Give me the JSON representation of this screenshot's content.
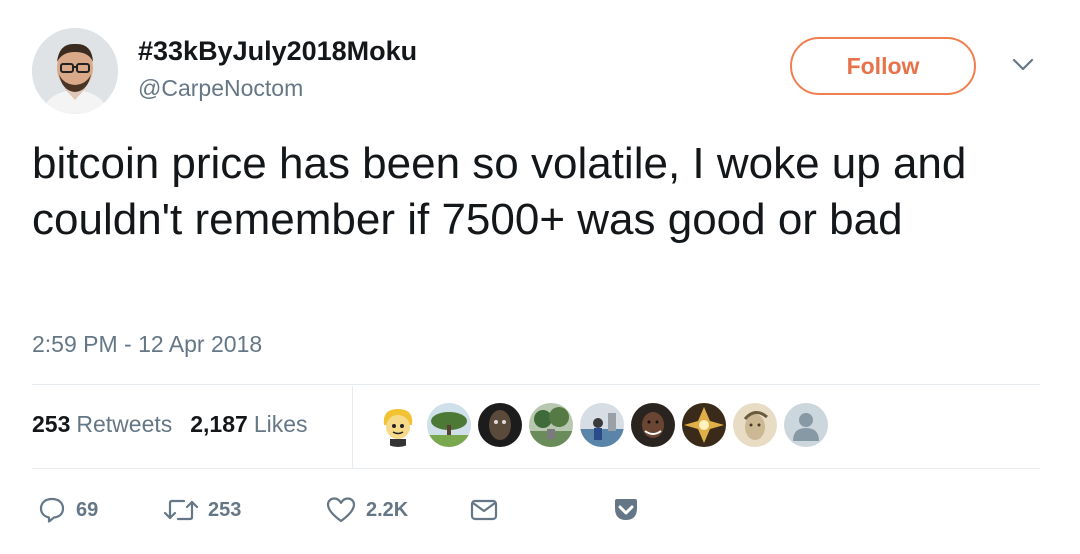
{
  "user": {
    "display_name": "#33kByJuly2018Moku",
    "handle": "@CarpeNoctom",
    "avatar_icon": "profile-photo"
  },
  "follow_button": {
    "label": "Follow",
    "accent": "#f07f4f"
  },
  "menu_icon": "chevron-down-icon",
  "tweet": {
    "text": "bitcoin price has been so volatile, I woke up and couldn't remember if 7500+ was good or bad",
    "timestamp": "2:59 PM - 12 Apr 2018"
  },
  "stats": {
    "retweets_count": "253",
    "retweets_label": "Retweets",
    "likes_count": "2,187",
    "likes_label": "Likes"
  },
  "likers": [
    {
      "icon": "cartoon-avatar",
      "color": "#f1c232"
    },
    {
      "icon": "tree-avatar",
      "color": "#6a9a4a"
    },
    {
      "icon": "dark-avatar",
      "color": "#2a2a2a"
    },
    {
      "icon": "landscape-avatar",
      "color": "#556b4a"
    },
    {
      "icon": "photo-avatar",
      "color": "#7a95b0"
    },
    {
      "icon": "person-avatar",
      "color": "#3a2a22"
    },
    {
      "icon": "emblem-avatar",
      "color": "#c89a3a"
    },
    {
      "icon": "sketch-avatar",
      "color": "#d8c8a8"
    },
    {
      "icon": "default-avatar",
      "color": "#ccd6dd"
    }
  ],
  "actions": {
    "reply_count": "69",
    "retweet_count": "253",
    "like_count": "2.2K"
  }
}
